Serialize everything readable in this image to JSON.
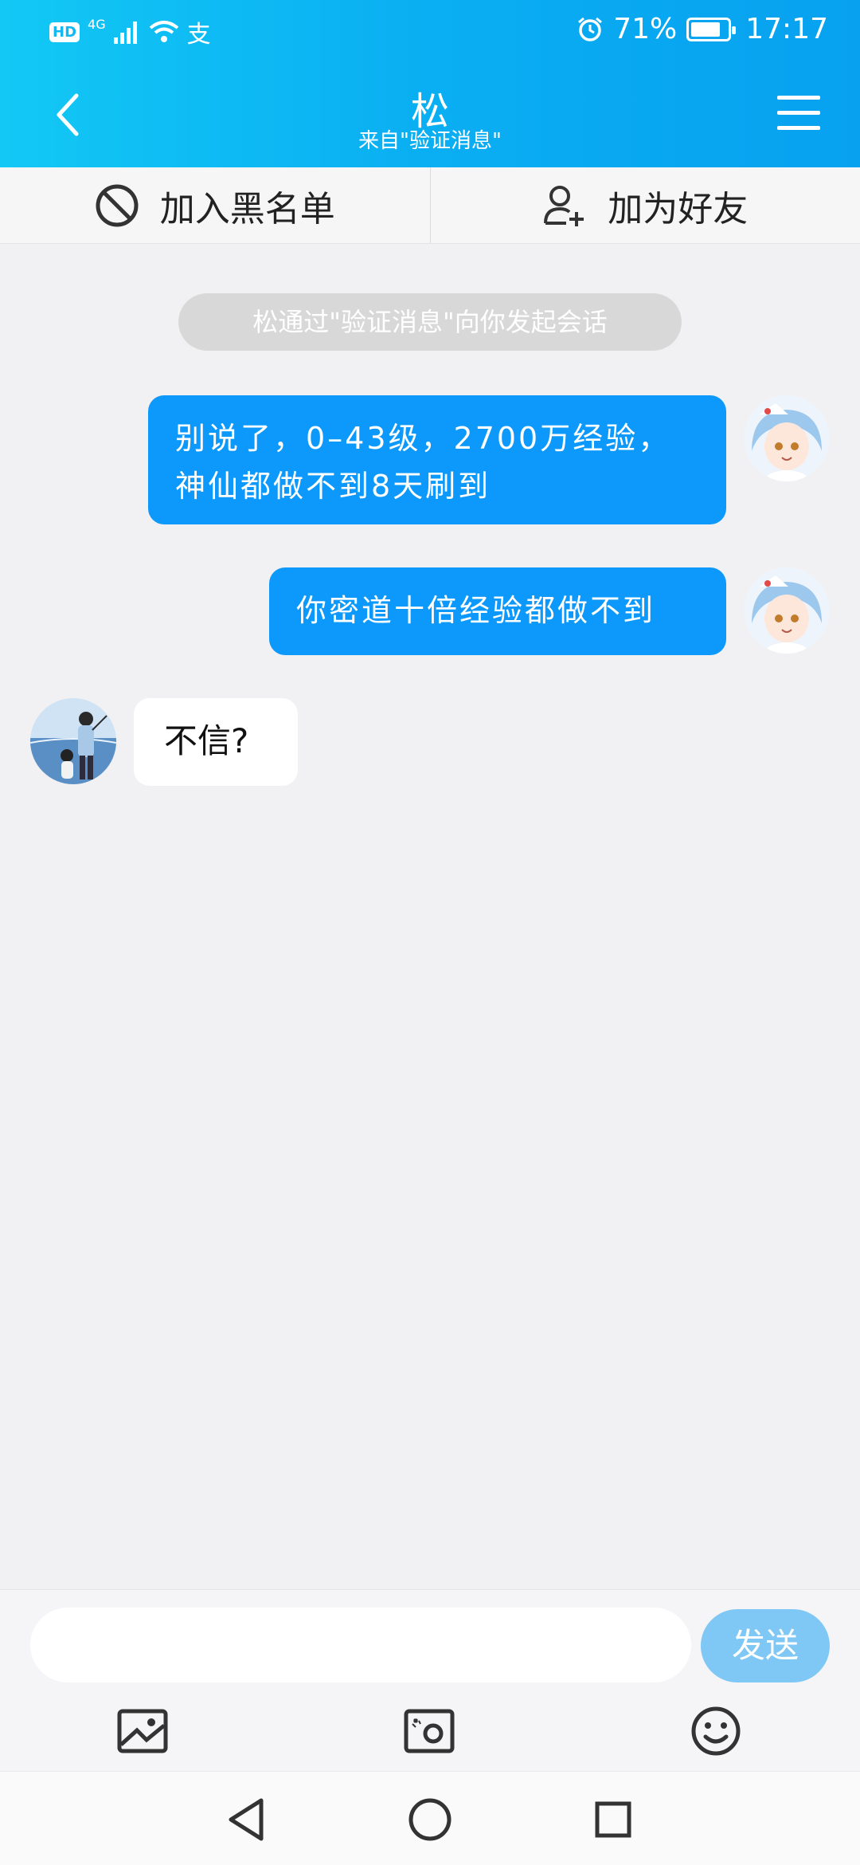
{
  "status_bar": {
    "hd_label": "HD",
    "network": "4G",
    "alipay_glyph": "支",
    "battery_percent": "71%",
    "time": "17:17"
  },
  "header": {
    "title": "松",
    "subtitle": "来自\"验证消息\""
  },
  "actions": {
    "blacklist_label": "加入黑名单",
    "add_friend_label": "加为好友"
  },
  "system_note": "松通过\"验证消息\"向你发起会话",
  "messages": [
    {
      "from": "me",
      "text": "别说了，0–43级，2700万经验，神仙都做不到8天刷到"
    },
    {
      "from": "me",
      "text": "你密道十倍经验都做不到"
    },
    {
      "from": "other",
      "text": "不信?"
    }
  ],
  "composer": {
    "input_placeholder": "",
    "send_label": "发送"
  },
  "icons": {
    "back": "chevron-left-icon",
    "menu": "hamburger-menu-icon",
    "blacklist": "block-icon",
    "add_friend": "add-user-icon",
    "image": "image-icon",
    "camera": "camera-icon",
    "emoji": "emoji-icon"
  },
  "colors": {
    "header_start": "#12c8f5",
    "header_end": "#07a1f0",
    "my_bubble": "#0d99fb",
    "send_button": "#7fc8f5"
  }
}
